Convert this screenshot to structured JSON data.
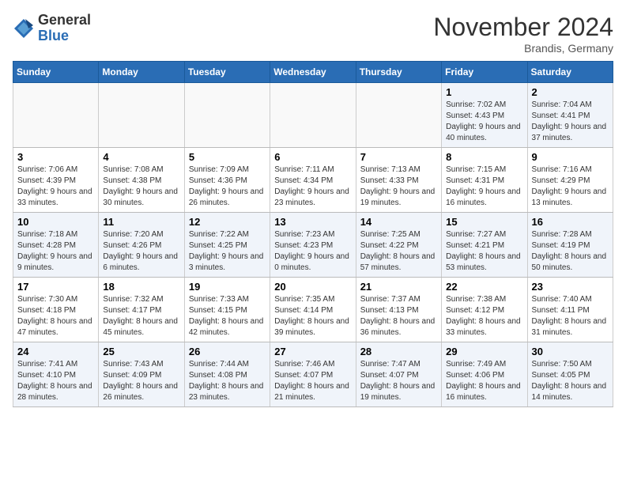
{
  "header": {
    "logo_general": "General",
    "logo_blue": "Blue",
    "month_title": "November 2024",
    "location": "Brandis, Germany"
  },
  "days_of_week": [
    "Sunday",
    "Monday",
    "Tuesday",
    "Wednesday",
    "Thursday",
    "Friday",
    "Saturday"
  ],
  "weeks": [
    [
      {
        "day": "",
        "info": ""
      },
      {
        "day": "",
        "info": ""
      },
      {
        "day": "",
        "info": ""
      },
      {
        "day": "",
        "info": ""
      },
      {
        "day": "",
        "info": ""
      },
      {
        "day": "1",
        "info": "Sunrise: 7:02 AM\nSunset: 4:43 PM\nDaylight: 9 hours and 40 minutes."
      },
      {
        "day": "2",
        "info": "Sunrise: 7:04 AM\nSunset: 4:41 PM\nDaylight: 9 hours and 37 minutes."
      }
    ],
    [
      {
        "day": "3",
        "info": "Sunrise: 7:06 AM\nSunset: 4:39 PM\nDaylight: 9 hours and 33 minutes."
      },
      {
        "day": "4",
        "info": "Sunrise: 7:08 AM\nSunset: 4:38 PM\nDaylight: 9 hours and 30 minutes."
      },
      {
        "day": "5",
        "info": "Sunrise: 7:09 AM\nSunset: 4:36 PM\nDaylight: 9 hours and 26 minutes."
      },
      {
        "day": "6",
        "info": "Sunrise: 7:11 AM\nSunset: 4:34 PM\nDaylight: 9 hours and 23 minutes."
      },
      {
        "day": "7",
        "info": "Sunrise: 7:13 AM\nSunset: 4:33 PM\nDaylight: 9 hours and 19 minutes."
      },
      {
        "day": "8",
        "info": "Sunrise: 7:15 AM\nSunset: 4:31 PM\nDaylight: 9 hours and 16 minutes."
      },
      {
        "day": "9",
        "info": "Sunrise: 7:16 AM\nSunset: 4:29 PM\nDaylight: 9 hours and 13 minutes."
      }
    ],
    [
      {
        "day": "10",
        "info": "Sunrise: 7:18 AM\nSunset: 4:28 PM\nDaylight: 9 hours and 9 minutes."
      },
      {
        "day": "11",
        "info": "Sunrise: 7:20 AM\nSunset: 4:26 PM\nDaylight: 9 hours and 6 minutes."
      },
      {
        "day": "12",
        "info": "Sunrise: 7:22 AM\nSunset: 4:25 PM\nDaylight: 9 hours and 3 minutes."
      },
      {
        "day": "13",
        "info": "Sunrise: 7:23 AM\nSunset: 4:23 PM\nDaylight: 9 hours and 0 minutes."
      },
      {
        "day": "14",
        "info": "Sunrise: 7:25 AM\nSunset: 4:22 PM\nDaylight: 8 hours and 57 minutes."
      },
      {
        "day": "15",
        "info": "Sunrise: 7:27 AM\nSunset: 4:21 PM\nDaylight: 8 hours and 53 minutes."
      },
      {
        "day": "16",
        "info": "Sunrise: 7:28 AM\nSunset: 4:19 PM\nDaylight: 8 hours and 50 minutes."
      }
    ],
    [
      {
        "day": "17",
        "info": "Sunrise: 7:30 AM\nSunset: 4:18 PM\nDaylight: 8 hours and 47 minutes."
      },
      {
        "day": "18",
        "info": "Sunrise: 7:32 AM\nSunset: 4:17 PM\nDaylight: 8 hours and 45 minutes."
      },
      {
        "day": "19",
        "info": "Sunrise: 7:33 AM\nSunset: 4:15 PM\nDaylight: 8 hours and 42 minutes."
      },
      {
        "day": "20",
        "info": "Sunrise: 7:35 AM\nSunset: 4:14 PM\nDaylight: 8 hours and 39 minutes."
      },
      {
        "day": "21",
        "info": "Sunrise: 7:37 AM\nSunset: 4:13 PM\nDaylight: 8 hours and 36 minutes."
      },
      {
        "day": "22",
        "info": "Sunrise: 7:38 AM\nSunset: 4:12 PM\nDaylight: 8 hours and 33 minutes."
      },
      {
        "day": "23",
        "info": "Sunrise: 7:40 AM\nSunset: 4:11 PM\nDaylight: 8 hours and 31 minutes."
      }
    ],
    [
      {
        "day": "24",
        "info": "Sunrise: 7:41 AM\nSunset: 4:10 PM\nDaylight: 8 hours and 28 minutes."
      },
      {
        "day": "25",
        "info": "Sunrise: 7:43 AM\nSunset: 4:09 PM\nDaylight: 8 hours and 26 minutes."
      },
      {
        "day": "26",
        "info": "Sunrise: 7:44 AM\nSunset: 4:08 PM\nDaylight: 8 hours and 23 minutes."
      },
      {
        "day": "27",
        "info": "Sunrise: 7:46 AM\nSunset: 4:07 PM\nDaylight: 8 hours and 21 minutes."
      },
      {
        "day": "28",
        "info": "Sunrise: 7:47 AM\nSunset: 4:07 PM\nDaylight: 8 hours and 19 minutes."
      },
      {
        "day": "29",
        "info": "Sunrise: 7:49 AM\nSunset: 4:06 PM\nDaylight: 8 hours and 16 minutes."
      },
      {
        "day": "30",
        "info": "Sunrise: 7:50 AM\nSunset: 4:05 PM\nDaylight: 8 hours and 14 minutes."
      }
    ]
  ]
}
